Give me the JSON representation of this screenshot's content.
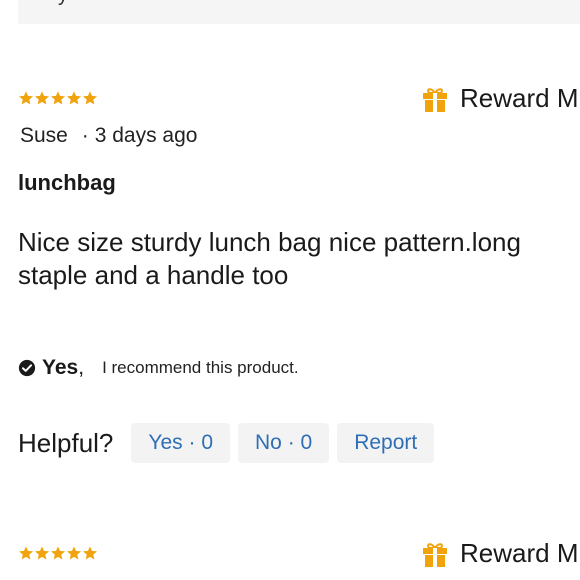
{
  "top_panel": {
    "text": "y"
  },
  "reviews": [
    {
      "rating": 5,
      "reward_label": "Reward M",
      "author": "Suse",
      "separator": "·",
      "time": "3 days ago",
      "title": "lunchbag",
      "body": "Nice size sturdy lunch bag nice pattern.long staple and a handle too",
      "recommend_yes": "Yes",
      "recommend_comma": ",",
      "recommend_text": "I recommend this product.",
      "helpful_label": "Helpful?",
      "yes_btn": "Yes · 0",
      "no_btn": "No · 0",
      "report_btn": "Report"
    },
    {
      "rating": 5,
      "reward_label": "Reward M"
    }
  ],
  "colors": {
    "star": "#f0a30a",
    "link": "#2f6eb5",
    "gift": "#f0a30a",
    "pill_bg": "#f3f3f3"
  },
  "icons": {
    "star": "star-icon",
    "gift": "gift-icon",
    "check": "check-circle-icon"
  }
}
